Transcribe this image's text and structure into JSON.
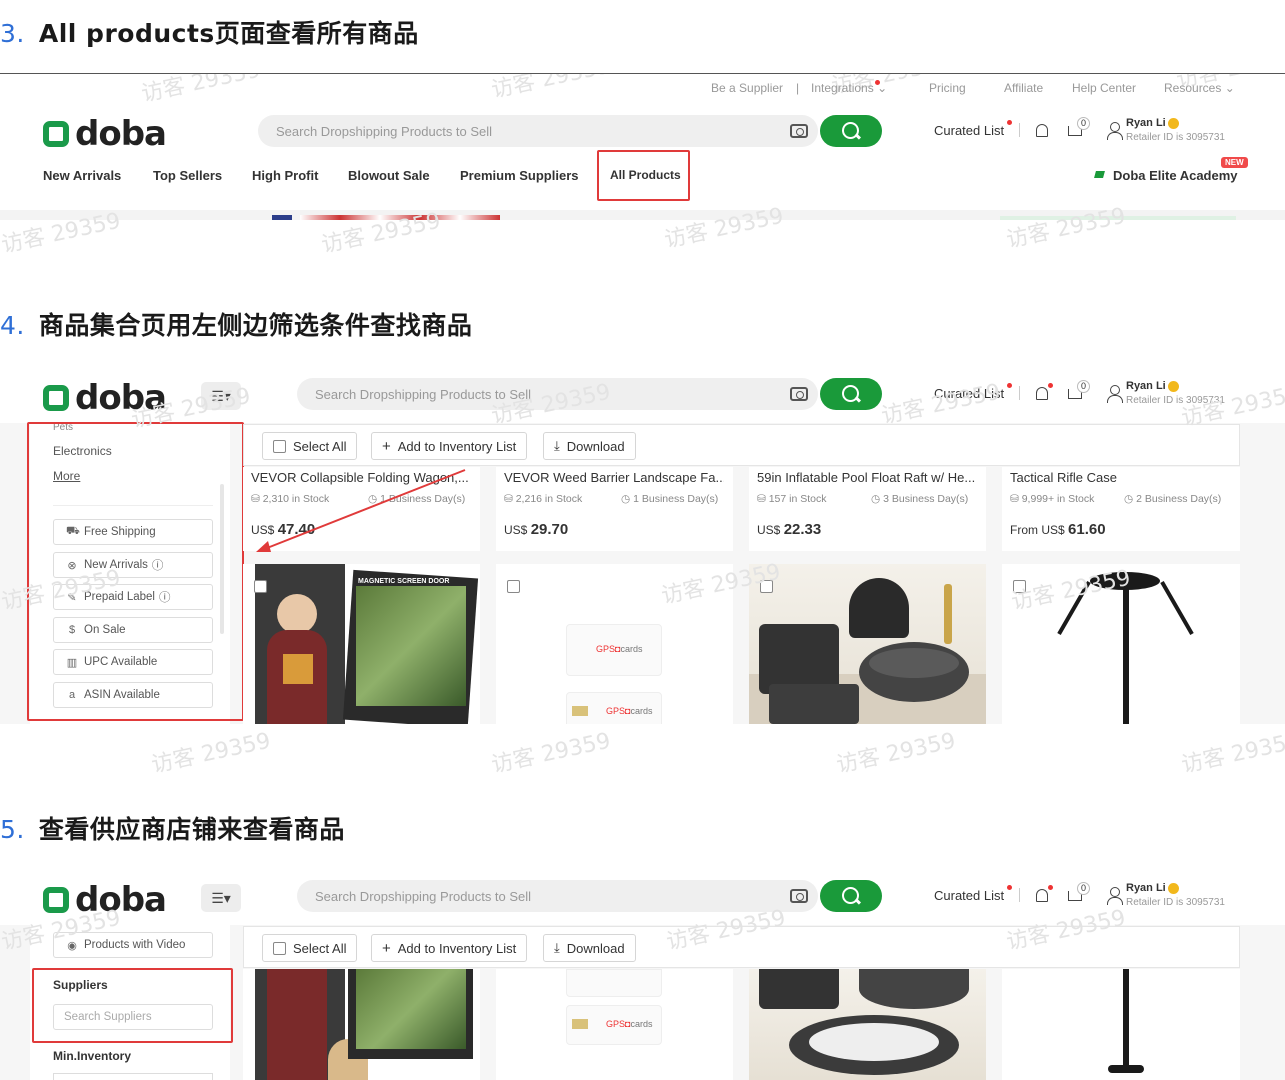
{
  "headings": [
    {
      "num": "3.",
      "text": "All products页面查看所有商品"
    },
    {
      "num": "4.",
      "text": "商品集合页用左侧边筛选条件查找商品"
    },
    {
      "num": "5.",
      "text": "查看供应商店铺来查看商品"
    }
  ],
  "watermark": "访客 29359",
  "header": {
    "logo": "doba",
    "search_placeholder": "Search Dropshipping Products to Sell",
    "curated_list": "Curated List",
    "notification_count": "0",
    "user_name": "Ryan Li",
    "user_id": "Retailer ID is 3095731"
  },
  "top_links": {
    "supplier": "Be a Supplier",
    "separator": "|",
    "integrations": "Integrations",
    "pricing": "Pricing",
    "affiliate": "Affiliate",
    "help": "Help Center",
    "resources": "Resources"
  },
  "nav": {
    "new_arrivals": "New Arrivals",
    "top_sellers": "Top Sellers",
    "high_profit": "High Profit",
    "blowout": "Blowout Sale",
    "premium": "Premium Suppliers",
    "all_products": "All Products",
    "academy": "Doba Elite Academy",
    "new_tag": "NEW"
  },
  "toolbar": {
    "select_all": "Select All",
    "add_inventory": "Add to Inventory List",
    "download": "Download"
  },
  "sidebar": {
    "pets": "Pets",
    "electronics": "Electronics",
    "more": "More",
    "free_shipping": "Free Shipping",
    "new_arrivals": "New Arrivals",
    "prepaid_label": "Prepaid Label",
    "on_sale": "On Sale",
    "upc": "UPC Available",
    "asin": "ASIN Available",
    "products_video": "Products with Video",
    "suppliers_title": "Suppliers",
    "search_suppliers": "Search Suppliers",
    "min_inventory": "Min.Inventory"
  },
  "products": [
    {
      "title": "VEVOR Collapsible Folding Wagon,...",
      "stock": "2,310 in Stock",
      "ship": "1 Business Day(s)",
      "prefix": "US$",
      "price": "47.40"
    },
    {
      "title": "VEVOR Weed Barrier Landscape Fa...",
      "stock": "2,216 in Stock",
      "ship": "1 Business Day(s)",
      "prefix": "US$",
      "price": "29.70"
    },
    {
      "title": "59in Inflatable Pool Float Raft w/ He...",
      "stock": "157 in Stock",
      "ship": "3 Business Day(s)",
      "prefix": "US$",
      "price": "22.33"
    },
    {
      "title": "Tactical Rifle Case",
      "stock": "9,999+ in Stock",
      "ship": "2 Business Day(s)",
      "prefix": "From US$",
      "price": "61.60"
    }
  ],
  "image_text": {
    "screen_door": "MAGNETIC SCREEN DOOR",
    "gps1_a": "GPS",
    "gps1_b": "cards",
    "gps2_a": "GPS",
    "gps2_b": "cards"
  },
  "colors": {
    "brand_green": "#1a9a3a",
    "highlight_red": "#e03a3a",
    "heading_number": "#2f6fd6"
  }
}
